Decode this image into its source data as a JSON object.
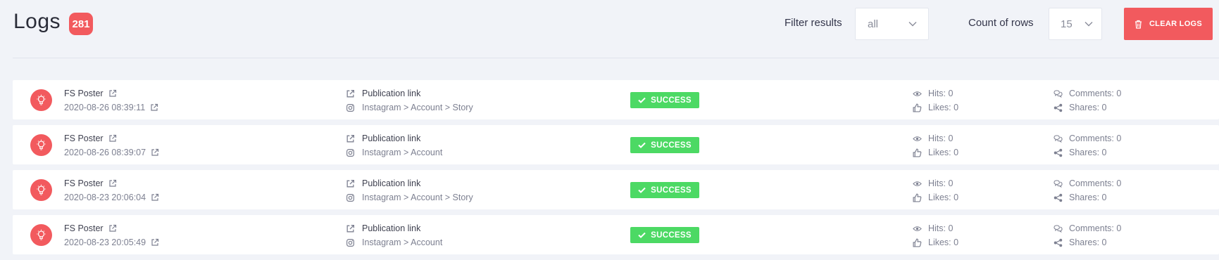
{
  "header": {
    "title": "Logs",
    "count": "281",
    "filter_label": "Filter results",
    "filter_value": "all",
    "rows_label": "Count of rows",
    "rows_value": "15",
    "clear_label": "CLEAR LOGS"
  },
  "colors": {
    "accent": "#f25a5e",
    "success": "#4cd964",
    "background": "#f1f3f8"
  },
  "icons": {
    "avatar": "lightbulb-icon",
    "external": "external-link-icon",
    "platform": "instagram-icon",
    "hits": "eye-icon",
    "likes": "thumbs-up-icon",
    "comments": "comments-icon",
    "shares": "share-icon",
    "status": "check-icon",
    "clear": "trash-icon"
  },
  "logs": [
    {
      "name": "FS Poster",
      "date": "2020-08-26 08:39:11",
      "link_label": "Publication link",
      "path": "Instagram > Account > Story",
      "status": "SUCCESS",
      "hits": "Hits: 0",
      "likes": "Likes: 0",
      "comments": "Comments: 0",
      "shares": "Shares: 0"
    },
    {
      "name": "FS Poster",
      "date": "2020-08-26 08:39:07",
      "link_label": "Publication link",
      "path": "Instagram > Account",
      "status": "SUCCESS",
      "hits": "Hits: 0",
      "likes": "Likes: 0",
      "comments": "Comments: 0",
      "shares": "Shares: 0"
    },
    {
      "name": "FS Poster",
      "date": "2020-08-23 20:06:04",
      "link_label": "Publication link",
      "path": "Instagram > Account > Story",
      "status": "SUCCESS",
      "hits": "Hits: 0",
      "likes": "Likes: 0",
      "comments": "Comments: 0",
      "shares": "Shares: 0"
    },
    {
      "name": "FS Poster",
      "date": "2020-08-23 20:05:49",
      "link_label": "Publication link",
      "path": "Instagram > Account",
      "status": "SUCCESS",
      "hits": "Hits: 0",
      "likes": "Likes: 0",
      "comments": "Comments: 0",
      "shares": "Shares: 0"
    }
  ]
}
